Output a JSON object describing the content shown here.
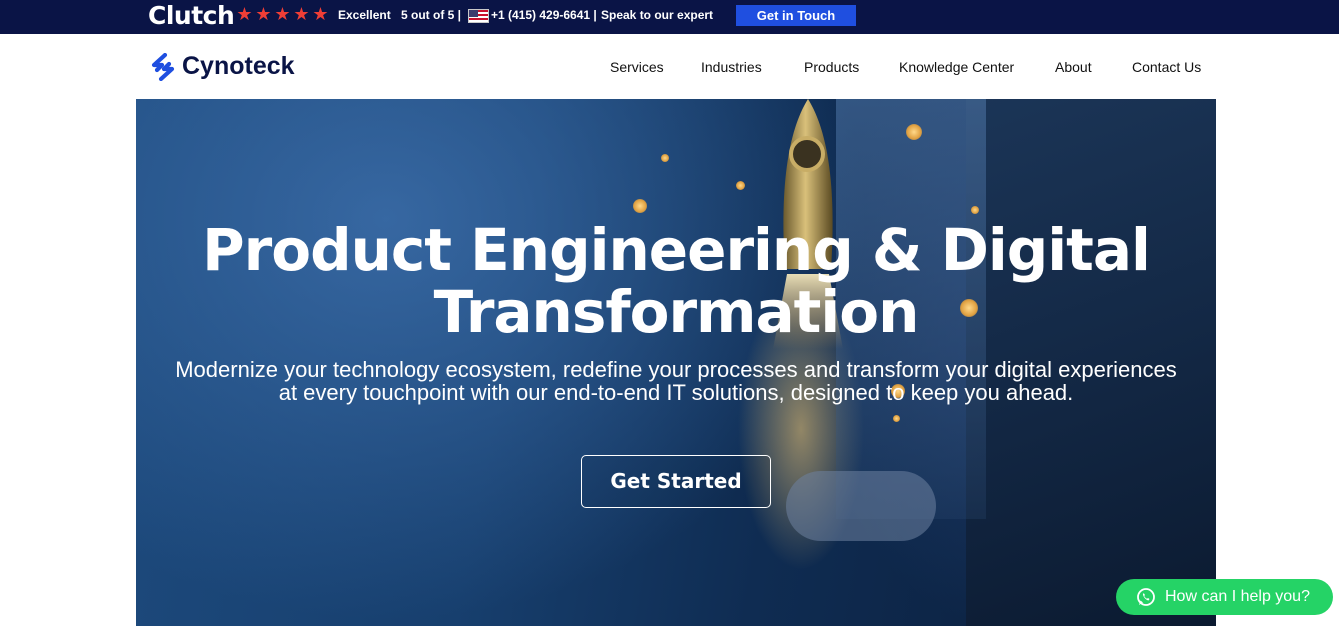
{
  "topbar": {
    "clutch_text": "Clutch",
    "rating_stars": 5,
    "rating_label": "Excellent",
    "rating_score": "5 out of 5 |",
    "phone": "+1 (415) 429-6641 |",
    "speak_text": "Speak to our expert",
    "cta_label": "Get in Touch",
    "colors": {
      "bar": "#0a1446",
      "star": "#ef3e36",
      "cta": "#1f4fe0"
    }
  },
  "header": {
    "brand": "Cynoteck",
    "nav": [
      {
        "label": "Services"
      },
      {
        "label": "Industries"
      },
      {
        "label": "Products"
      },
      {
        "label": "Knowledge Center"
      },
      {
        "label": "About"
      },
      {
        "label": "Contact Us"
      }
    ]
  },
  "hero": {
    "title_line1": "Product Engineering & Digital",
    "title_line2": "Transformation",
    "subtitle_line1": "Modernize your technology ecosystem, redefine your processes and transform your digital experiences",
    "subtitle_line2": "at every touchpoint with our end-to-end IT solutions, designed to keep you ahead.",
    "cta_label": "Get Started"
  },
  "chat": {
    "label": "How can I help you?",
    "icon": "whatsapp-icon",
    "color": "#25d366"
  }
}
